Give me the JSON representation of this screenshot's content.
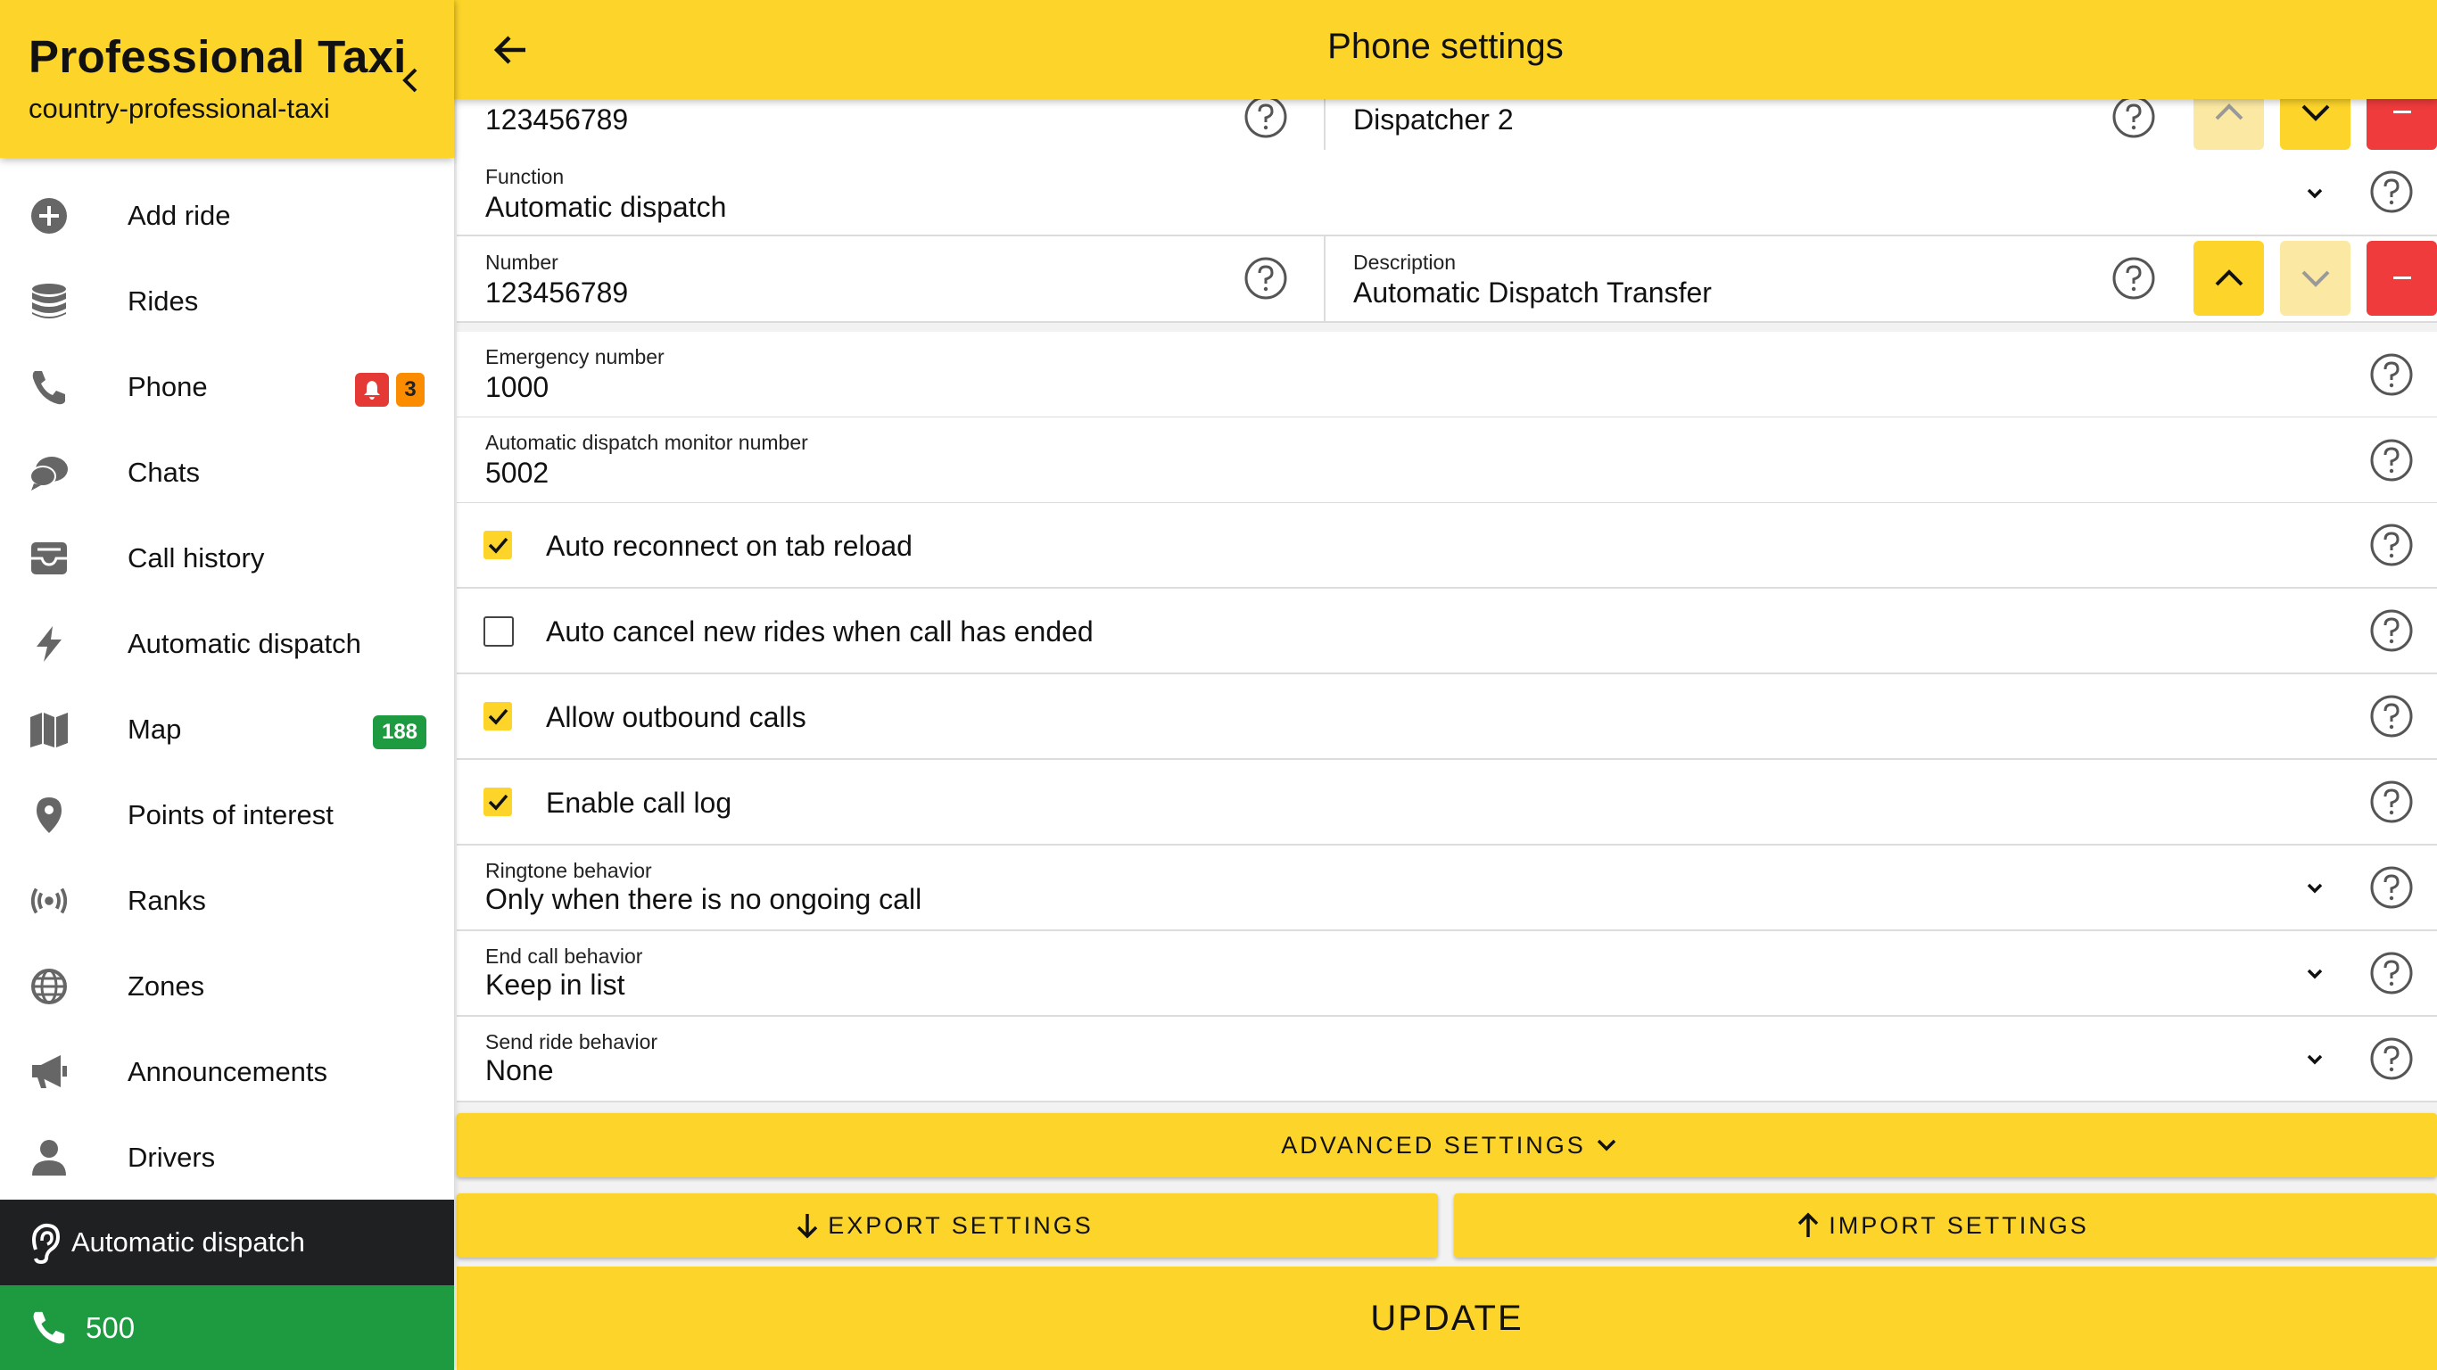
{
  "sidebar": {
    "brand_title": "Professional Taxi",
    "brand_subtitle": "country-professional-taxi",
    "items": [
      {
        "label": "Add ride",
        "icon": "plus-circle-icon"
      },
      {
        "label": "Rides",
        "icon": "database-icon"
      },
      {
        "label": "Phone",
        "icon": "phone-icon",
        "badge_alert_icon": "bell-icon",
        "badge_count": "3"
      },
      {
        "label": "Chats",
        "icon": "chat-bubbles-icon"
      },
      {
        "label": "Call history",
        "icon": "inbox-icon"
      },
      {
        "label": "Automatic dispatch",
        "icon": "lightning-icon"
      },
      {
        "label": "Map",
        "icon": "map-icon",
        "badge": "188"
      },
      {
        "label": "Points of interest",
        "icon": "map-pin-icon"
      },
      {
        "label": "Ranks",
        "icon": "broadcast-icon"
      },
      {
        "label": "Zones",
        "icon": "globe-icon"
      },
      {
        "label": "Announcements",
        "icon": "megaphone-icon"
      },
      {
        "label": "Drivers",
        "icon": "person-icon"
      }
    ],
    "status_dispatch": "Automatic dispatch",
    "status_phone": "500"
  },
  "header": {
    "title": "Phone settings"
  },
  "form": {
    "top_row": {
      "number": "123456789",
      "description": "Dispatcher 2"
    },
    "function": {
      "caption": "Function",
      "value": "Automatic dispatch"
    },
    "transfer_row": {
      "number_caption": "Number",
      "number": "123456789",
      "description_caption": "Description",
      "description": "Automatic Dispatch Transfer"
    },
    "emergency": {
      "caption": "Emergency number",
      "value": "1000"
    },
    "monitor": {
      "caption": "Automatic dispatch monitor number",
      "value": "5002"
    },
    "checkboxes": [
      {
        "label": "Auto reconnect on tab reload",
        "checked": true
      },
      {
        "label": "Auto cancel new rides when call has ended",
        "checked": false
      },
      {
        "label": "Allow outbound calls",
        "checked": true
      },
      {
        "label": "Enable call log",
        "checked": true
      }
    ],
    "ringtone": {
      "caption": "Ringtone behavior",
      "value": "Only when there is no ongoing call"
    },
    "end_call": {
      "caption": "End call behavior",
      "value": "Keep in list"
    },
    "send_ride": {
      "caption": "Send ride behavior",
      "value": "None"
    }
  },
  "actions": {
    "advanced": "ADVANCED SETTINGS",
    "export": "EXPORT SETTINGS",
    "import": "IMPORT SETTINGS",
    "update": "UPDATE"
  },
  "colors": {
    "accent": "#fdd52a",
    "danger": "#ef3b3b",
    "success": "#1e9a40",
    "dark": "#1e2022"
  }
}
